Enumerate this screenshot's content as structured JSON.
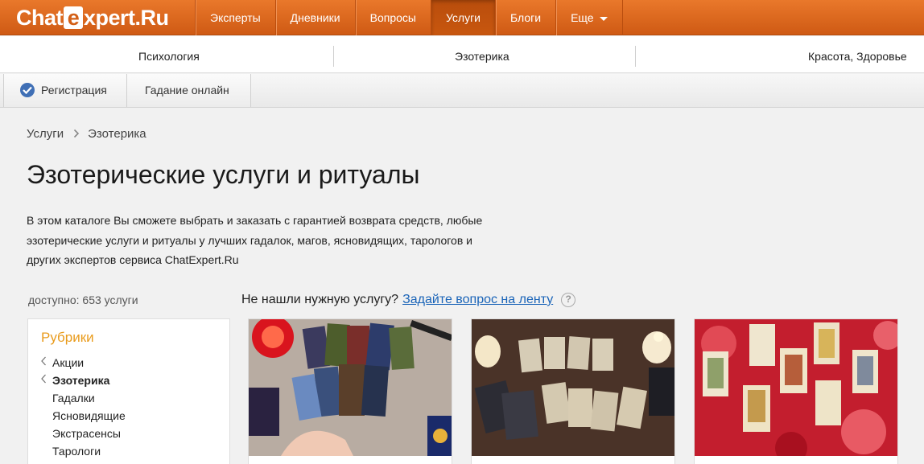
{
  "header": {
    "logo_left": "Chat",
    "logo_e": "e",
    "logo_right": "xpert.Ru",
    "nav": [
      "Эксперты",
      "Дневники",
      "Вопросы",
      "Услуги",
      "Блоги",
      "Еще"
    ],
    "active_nav": "Услуги"
  },
  "categories": [
    "Психология",
    "Эзотерика",
    "Красота, Здоровье"
  ],
  "subtabs": {
    "register": "Регистрация",
    "fortune": "Гадание онлайн"
  },
  "breadcrumb": {
    "root": "Услуги",
    "current": "Эзотерика"
  },
  "page": {
    "title": "Эзотерические услуги и ритуалы",
    "description": "В этом каталоге Вы сможете выбрать и заказать с гарантией возврата средств, любые эзотерические услуги и ритуалы у лучших гадалок, магов, ясновидящих, тарологов и других экспертов сервиса ChatExpert.Ru",
    "available": "доступно: 653 услуги",
    "not_found_text": "Не нашли нужную услугу?",
    "ask_link": "Задайте вопрос на ленту",
    "help_glyph": "?"
  },
  "rubrics": {
    "title": "Рубрики",
    "items": [
      {
        "label": "Акции",
        "chevron": true,
        "bold": false
      },
      {
        "label": "Эзотерика",
        "chevron": true,
        "bold": true
      },
      {
        "label": "Гадалки",
        "chevron": false,
        "bold": false
      },
      {
        "label": "Ясновидящие",
        "chevron": false,
        "bold": false
      },
      {
        "label": "Экстрасенсы",
        "chevron": false,
        "bold": false
      },
      {
        "label": "Тарологи",
        "chevron": false,
        "bold": false
      }
    ]
  },
  "colors": {
    "brand_orange": "#d96616",
    "link_blue": "#1a64b8",
    "rubric_title": "#e99b1c"
  }
}
